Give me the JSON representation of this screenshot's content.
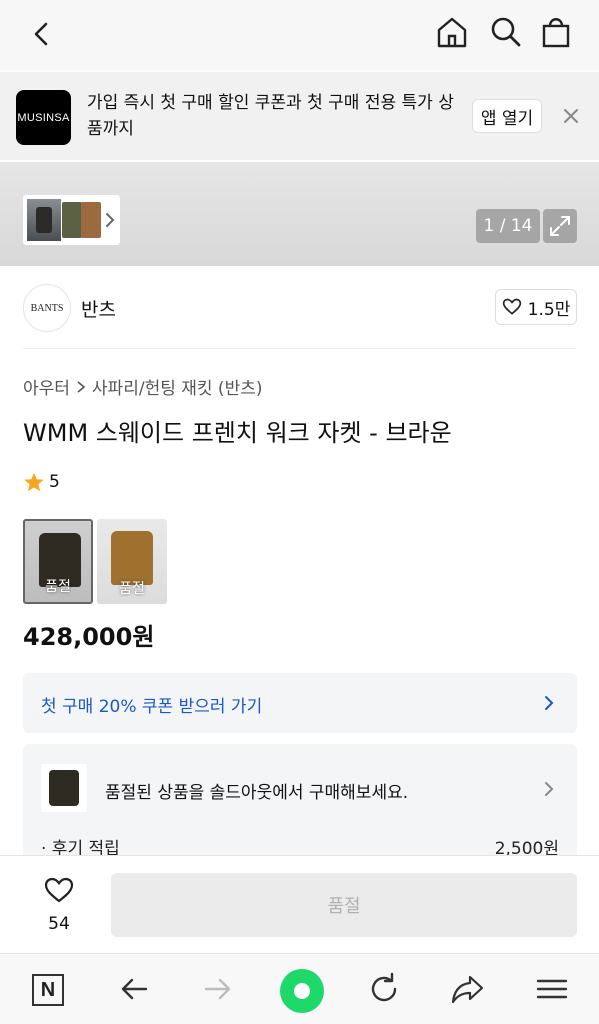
{
  "banner": {
    "logo_text": "MUSINSA",
    "message": "가입 즉시 첫 구매 할인 쿠폰과 첫 구매 전용 특가 상품까지",
    "open_app_label": "앱 열기"
  },
  "gallery": {
    "counter": "1 / 14"
  },
  "brand": {
    "logo_text": "BANTS",
    "name": "반츠",
    "likes": "1.5만"
  },
  "breadcrumb": {
    "category": "아우터",
    "subcategory": "사파리/헌팅 재킷 (반츠)"
  },
  "product": {
    "title": "WMM 스웨이드 프렌치 워크 자켓 - 브라운",
    "rating": "5",
    "price": "428,000원",
    "options": [
      {
        "label": "품절",
        "color": "#2f2b22"
      },
      {
        "label": "품절",
        "color": "#a0702e"
      }
    ]
  },
  "coupon": {
    "label": "첫 구매 20% 쿠폰 받으러 가기"
  },
  "soldout": {
    "message": "품절된 상품을 솔드아웃에서 구매해보세요.",
    "review_label": "· 후기 적립",
    "review_value": "2,500원"
  },
  "action": {
    "wish_count": "54",
    "buy_label": "품절"
  },
  "browser_bar": {
    "n_label": "N"
  },
  "colors": {
    "accent_blue": "#1a57c9",
    "star": "#f6a623",
    "naver_green": "#1ed86a"
  }
}
